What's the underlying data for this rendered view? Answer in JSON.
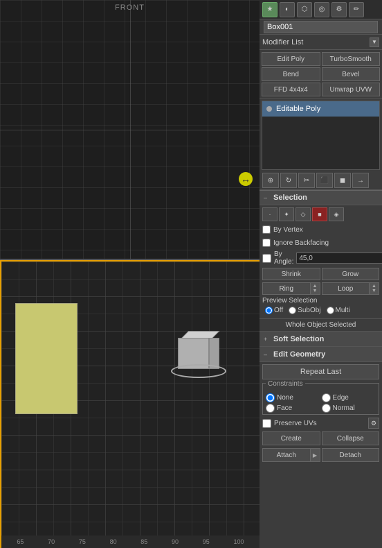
{
  "toolbar": {
    "icons": [
      "★",
      "◐",
      "⬡",
      "◎",
      "⚙",
      "✏"
    ]
  },
  "object": {
    "name": "Box001"
  },
  "modifier": {
    "list_label": "Modifier List",
    "buttons": [
      {
        "label": "Edit Poly",
        "id": "edit-poly"
      },
      {
        "label": "TurboSmooth",
        "id": "turbo-smooth"
      },
      {
        "label": "Bend",
        "id": "bend"
      },
      {
        "label": "Bevel",
        "id": "bevel"
      },
      {
        "label": "FFD 4x4x4",
        "id": "ffd"
      },
      {
        "label": "Unwrap UVW",
        "id": "unwrap-uvw"
      }
    ],
    "stack": [
      {
        "label": "Editable Poly",
        "active": true,
        "id": "editable-poly"
      }
    ]
  },
  "subobj_toolbar": {
    "buttons": [
      "⊕",
      "⟳",
      "✂",
      "⬛",
      "◼",
      "➡"
    ]
  },
  "selection": {
    "section_title": "Selection",
    "icons": [
      "·",
      "✦",
      "◇",
      "■",
      "◈"
    ],
    "by_vertex_label": "By Vertex",
    "ignore_backfacing_label": "Ignore Backfacing",
    "by_angle_label": "By Angle:",
    "by_angle_value": "45,0",
    "shrink_label": "Shrink",
    "grow_label": "Grow",
    "ring_label": "Ring",
    "loop_label": "Loop",
    "preview_label": "Preview Selection",
    "preview_options": [
      "Off",
      "SubObj",
      "Multi"
    ],
    "status": "Whole Object Selected"
  },
  "soft_selection": {
    "section_title": "Soft Selection",
    "collapsed": true
  },
  "edit_geometry": {
    "section_title": "Edit Geometry",
    "repeat_last_label": "Repeat Last",
    "constraints_title": "Constraints",
    "constraints": [
      "None",
      "Edge",
      "Face",
      "Normal"
    ],
    "preserve_uvs_label": "Preserve UVs",
    "create_label": "Create",
    "collapse_label": "Collapse",
    "attach_label": "Attach",
    "detach_label": "Detach"
  },
  "viewport": {
    "top_label": "FRONT",
    "ruler_marks": [
      "65",
      "70",
      "75",
      "80",
      "85",
      "90",
      "95",
      "100"
    ]
  }
}
